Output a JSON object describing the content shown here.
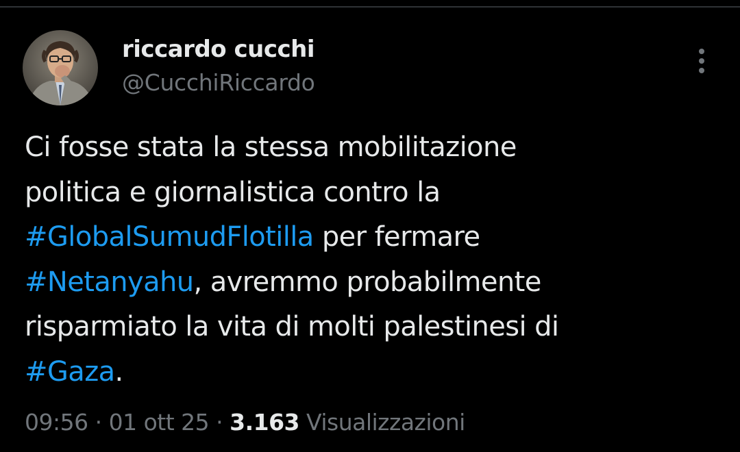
{
  "tweet": {
    "author": {
      "display_name": "riccardo cucchi",
      "handle": "@CucchiRiccardo"
    },
    "text_lines": [
      [
        "Ci fosse stata la stessa mobilitazione"
      ],
      [
        "politica e giornalistica contro la"
      ],
      [
        "#GlobalSumudFlotilla",
        " per fermare"
      ],
      [
        "#Netanyahu",
        ", avremmo probabilmente"
      ],
      [
        "risparmiato la vita di molti palestinesi di"
      ],
      [
        "#Gaza",
        "."
      ]
    ],
    "meta": {
      "time": "09:56",
      "separator": " · ",
      "date": "01 ott 25",
      "views_count": "3.163",
      "views_label": "Visualizzazioni"
    }
  },
  "icons": {
    "more": "more-vertical-icon"
  },
  "colors": {
    "background": "#000000",
    "text": "#e7e9ea",
    "secondary": "#71767b",
    "hashtag": "#1d9bf0"
  }
}
